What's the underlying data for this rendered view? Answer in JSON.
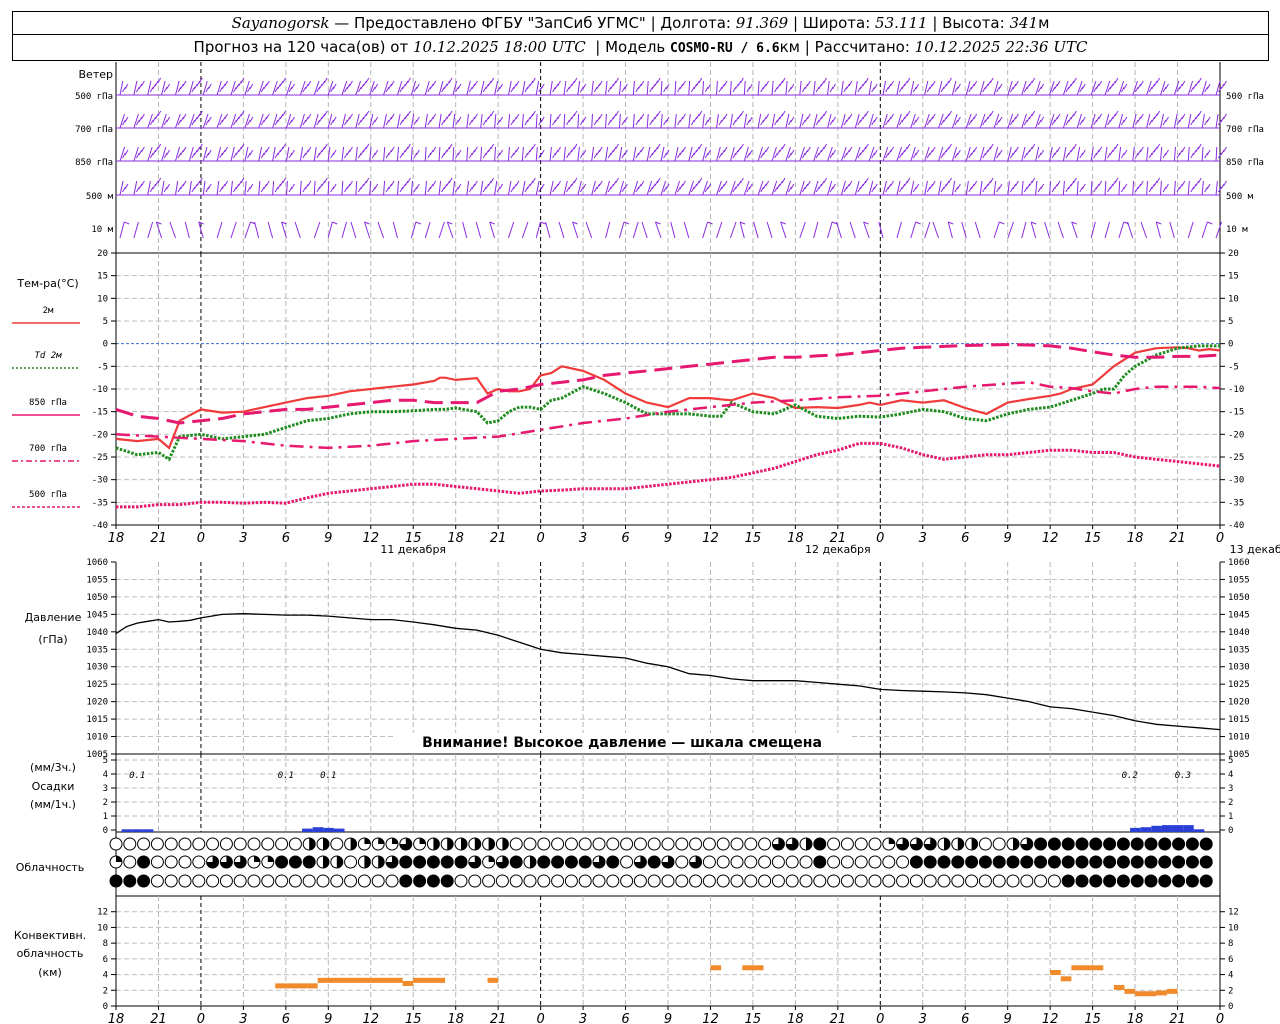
{
  "header": {
    "station": "Sayanogorsk",
    "provider": " — Предоставлено ФГБУ \"ЗапСиб УГМС\" | Долгота: ",
    "lon": "91.369",
    "lat_label": " | Широта: ",
    "lat": "53.111",
    "alt_label": " | Высота: ",
    "alt": "341",
    "alt_unit": "м",
    "forecast_prefix": "Прогноз на 120 часа(ов) от ",
    "forecast_start": "10.12.2025 18:00 UTC",
    "model_prefix": "  | Модель ",
    "model": "COSMO-RU / 6.6",
    "model_unit": "км",
    "calc_prefix": " | Рассчитано: ",
    "calc_time": "10.12.2025 22:36 UTC"
  },
  "wind_panel": {
    "title": "Ветер",
    "levels": [
      "500 гПа",
      "700 гПа",
      "850 гПа",
      "500 м",
      "10  м"
    ],
    "color": "#8a2be2"
  },
  "chart_data": [
    {
      "type": "line",
      "title": "Тем-ра(°C)",
      "x_ticks": [
        "18",
        "21",
        "0",
        "3",
        "6",
        "9",
        "12",
        "15",
        "18",
        "21",
        "0",
        "3",
        "6",
        "9",
        "12",
        "15",
        "18",
        "21",
        "0",
        "3",
        "6",
        "9",
        "12",
        "15",
        "18",
        "21",
        "0"
      ],
      "day_labels": [
        "11 декабря",
        "12 декабря",
        "13 декабря"
      ],
      "ylim": [
        -40,
        20
      ],
      "y_ticks": [
        20,
        15,
        10,
        5,
        0,
        -5,
        -10,
        -15,
        -20,
        -25,
        -30,
        -35,
        -40
      ],
      "series": [
        {
          "name": "2м",
          "color": "#ef3b3b",
          "style": "solid",
          "x": [
            0,
            2,
            4,
            5,
            6,
            8,
            10,
            12,
            14,
            16,
            18,
            20,
            22,
            24,
            26,
            28,
            30,
            30.5,
            31,
            32,
            34,
            35,
            36,
            37,
            38,
            39,
            40,
            41,
            42,
            44,
            46,
            48,
            50,
            52,
            54,
            56,
            57,
            58,
            60,
            62,
            64,
            66,
            68,
            70,
            71,
            72,
            74,
            76,
            78,
            80,
            82,
            84,
            86,
            88,
            89,
            90,
            92,
            93,
            94,
            96,
            98,
            100,
            101,
            102,
            103,
            104
          ],
          "values": [
            -21,
            -21.5,
            -21,
            -23,
            -17,
            -14.5,
            -15.2,
            -15,
            -14,
            -13,
            -12,
            -11.5,
            -10.5,
            -10,
            -9.5,
            -9,
            -8.2,
            -7.5,
            -7.5,
            -8,
            -7.6,
            -11,
            -10,
            -10.5,
            -10.5,
            -10,
            -7,
            -6.5,
            -5,
            -6,
            -8,
            -11,
            -13,
            -14,
            -12,
            -12,
            -12.3,
            -12.5,
            -11,
            -12,
            -14.2,
            -14.0,
            -14.2,
            -13.5,
            -13,
            -13.5,
            -12.5,
            -13,
            -12.5,
            -14.2,
            -15.5,
            -13,
            -12.2,
            -11.5,
            -11,
            -10,
            -9,
            -7,
            -5,
            -2,
            -1,
            -0.8,
            -1,
            -1.5,
            -1.2,
            -1.5
          ]
        },
        {
          "name": "Td 2м",
          "color": "#1e8c1e",
          "style": "dotted",
          "x": [
            0,
            2,
            4,
            5,
            6,
            8,
            10,
            12,
            14,
            16,
            18,
            20,
            22,
            24,
            26,
            28,
            30,
            31,
            32,
            34,
            35,
            36,
            37,
            38,
            39,
            40,
            41,
            42,
            44,
            46,
            48,
            50,
            52,
            54,
            56,
            57,
            58,
            60,
            62,
            64,
            66,
            68,
            70,
            72,
            74,
            76,
            78,
            80,
            82,
            84,
            86,
            88,
            90,
            92,
            93,
            94,
            95,
            96,
            98,
            100,
            102,
            104
          ],
          "values": [
            -23,
            -24.5,
            -24,
            -25.5,
            -20.5,
            -20,
            -21,
            -20.5,
            -20,
            -18.5,
            -17,
            -16.5,
            -15.5,
            -15,
            -15,
            -14.8,
            -14.5,
            -14.5,
            -14.2,
            -15,
            -17.5,
            -17,
            -15,
            -14,
            -14,
            -14.5,
            -12.5,
            -12,
            -9.5,
            -11,
            -13,
            -15.5,
            -15.5,
            -15.5,
            -16,
            -16,
            -13,
            -15,
            -15.5,
            -13.5,
            -16,
            -16.5,
            -16,
            -16.2,
            -15.5,
            -14.5,
            -15,
            -16.5,
            -17,
            -15.5,
            -14.5,
            -14,
            -12.5,
            -11,
            -10,
            -10,
            -7,
            -5,
            -2.5,
            -1,
            -0.5,
            -0.5
          ]
        },
        {
          "name": "850 гПа",
          "color": "#e6186f",
          "style": "longdash",
          "x": [
            0,
            2,
            4,
            6,
            8,
            10,
            12,
            14,
            16,
            18,
            20,
            22,
            24,
            26,
            28,
            30,
            32,
            34,
            36,
            38,
            40,
            42,
            44,
            46,
            48,
            50,
            52,
            54,
            56,
            58,
            60,
            62,
            64,
            66,
            68,
            70,
            72,
            74,
            76,
            78,
            80,
            82,
            84,
            86,
            88,
            90,
            92,
            94,
            96,
            98,
            100,
            102,
            104
          ],
          "values": [
            -14.5,
            -16,
            -16.5,
            -17.5,
            -17,
            -16.5,
            -15.5,
            -15,
            -14.5,
            -14.5,
            -14,
            -13.5,
            -13,
            -12.5,
            -12.5,
            -13,
            -13,
            -13,
            -10.5,
            -10,
            -9,
            -8.5,
            -8,
            -7,
            -6.5,
            -6,
            -5.5,
            -5,
            -4.5,
            -4,
            -3.5,
            -3,
            -3,
            -2.7,
            -2.5,
            -2,
            -1.5,
            -1,
            -0.8,
            -0.6,
            -0.4,
            -0.3,
            -0.2,
            -0.3,
            -0.5,
            -1,
            -1.8,
            -2.5,
            -3,
            -3,
            -2.8,
            -2.8,
            -2.5
          ]
        },
        {
          "name": "700 гПа",
          "color": "#e6186f",
          "style": "dashdot",
          "x": [
            0,
            4,
            8,
            12,
            16,
            20,
            24,
            28,
            32,
            36,
            40,
            44,
            48,
            52,
            56,
            60,
            64,
            68,
            72,
            76,
            80,
            84,
            86,
            88,
            90,
            92,
            94,
            96,
            98,
            100,
            102,
            104
          ],
          "values": [
            -20,
            -20.5,
            -21,
            -21.5,
            -22.5,
            -23,
            -22.5,
            -21.5,
            -21,
            -20.5,
            -19,
            -17.5,
            -16.5,
            -15,
            -14,
            -13,
            -12.5,
            -11.8,
            -11.5,
            -10.5,
            -9.5,
            -8.8,
            -8.5,
            -9.5,
            -9.8,
            -10.5,
            -11,
            -10,
            -9.5,
            -9.5,
            -9.5,
            -9.8
          ]
        },
        {
          "name": "500 гПа",
          "color": "#e6186f",
          "style": "densedot",
          "x": [
            0,
            2,
            4,
            6,
            8,
            10,
            12,
            14,
            16,
            18,
            20,
            22,
            24,
            26,
            28,
            30,
            32,
            34,
            36,
            38,
            40,
            42,
            44,
            46,
            48,
            50,
            52,
            54,
            56,
            58,
            60,
            62,
            64,
            66,
            68,
            70,
            72,
            74,
            76,
            78,
            80,
            82,
            84,
            86,
            88,
            90,
            92,
            94,
            96,
            98,
            100,
            102,
            104
          ],
          "values": [
            -36,
            -36,
            -35.5,
            -35.5,
            -35,
            -35,
            -35.2,
            -35,
            -35.2,
            -34,
            -33,
            -32.5,
            -32,
            -31.5,
            -31,
            -31,
            -31.5,
            -32,
            -32.5,
            -33,
            -32.5,
            -32.3,
            -32,
            -32,
            -32,
            -31.5,
            -31,
            -30.5,
            -30,
            -29.5,
            -28.5,
            -27.5,
            -26,
            -24.5,
            -23.5,
            -22,
            -22,
            -23,
            -24.5,
            -25.5,
            -25,
            -24.5,
            -24.5,
            -24,
            -23.5,
            -23.5,
            -24,
            -24,
            -25,
            -25.5,
            -26,
            -26.5,
            -27
          ]
        }
      ]
    },
    {
      "type": "line",
      "title": "Давление",
      "ylabel": "(гПа)",
      "ylim": [
        1005,
        1060
      ],
      "y_ticks": [
        1060,
        1055,
        1050,
        1045,
        1040,
        1035,
        1030,
        1025,
        1020,
        1015,
        1010,
        1005
      ],
      "note": "Внимание! Высокое давление — шкала смещена",
      "series": [
        {
          "name": "Давление",
          "color": "#000000",
          "x": [
            0,
            1,
            2,
            3,
            4,
            5,
            6,
            7,
            8,
            10,
            12,
            14,
            16,
            18,
            20,
            22,
            24,
            26,
            28,
            30,
            32,
            34,
            36,
            38,
            40,
            42,
            44,
            46,
            48,
            50,
            52,
            54,
            56,
            58,
            60,
            62,
            64,
            66,
            68,
            70,
            72,
            74,
            76,
            78,
            80,
            82,
            84,
            86,
            88,
            90,
            92,
            94,
            96,
            98,
            100,
            102,
            104
          ],
          "values": [
            1039.5,
            1041.5,
            1042.5,
            1043,
            1043.5,
            1042.8,
            1043,
            1043.3,
            1044,
            1045,
            1045.2,
            1045,
            1044.8,
            1044.8,
            1044.5,
            1044,
            1043.5,
            1043.5,
            1042.8,
            1042,
            1041,
            1040.5,
            1039,
            1037,
            1035,
            1034,
            1033.5,
            1033,
            1032.5,
            1031,
            1030,
            1028,
            1027.5,
            1026.5,
            1026,
            1026,
            1026,
            1025.5,
            1025,
            1024.5,
            1023.5,
            1023.2,
            1023,
            1022.8,
            1022.5,
            1022,
            1021,
            1020,
            1018.5,
            1018,
            1017,
            1016,
            1014.5,
            1013.5,
            1013,
            1012.5,
            1012
          ]
        }
      ]
    },
    {
      "type": "bar",
      "title": "Осадки",
      "ylabel_top": "(мм/3ч.)",
      "ylabel_bottom": "(мм/1ч.)",
      "ylim": [
        0,
        5
      ],
      "y_ticks": [
        5,
        4,
        3,
        2,
        1,
        0
      ],
      "annotations": [
        {
          "x": 2,
          "text": "0.1"
        },
        {
          "x": 16,
          "text": "0.1"
        },
        {
          "x": 20,
          "text": "0.1"
        },
        {
          "x": 95.5,
          "text": "0.2"
        },
        {
          "x": 100.5,
          "text": "0.3"
        }
      ],
      "series": [
        {
          "name": "Осадки",
          "color": "#2a3fd6",
          "x": [
            1,
            2,
            3,
            18,
            19,
            20,
            21,
            96,
            97,
            98,
            99,
            100,
            101,
            102
          ],
          "values": [
            0.05,
            0.05,
            0.05,
            0.1,
            0.2,
            0.15,
            0.1,
            0.15,
            0.2,
            0.3,
            0.35,
            0.35,
            0.35,
            0.05
          ]
        }
      ]
    },
    {
      "type": "bar",
      "title": "Конвективн. облачность",
      "ylabel": "(км)",
      "ylim": [
        0,
        14
      ],
      "y_ticks": [
        12,
        10,
        8,
        6,
        4,
        2,
        0
      ],
      "series": [
        {
          "name": "Конвективн. облачность",
          "color": "#f08a2a",
          "segments": [
            {
              "x0": 15,
              "x1": 18,
              "value": 2.5
            },
            {
              "x0": 18,
              "x1": 19,
              "value": 2.5
            },
            {
              "x0": 19,
              "x1": 27,
              "value": 3.2
            },
            {
              "x0": 27,
              "x1": 28,
              "value": 2.8
            },
            {
              "x0": 28,
              "x1": 31,
              "value": 3.2
            },
            {
              "x0": 35,
              "x1": 36,
              "value": 3.2
            },
            {
              "x0": 56,
              "x1": 57,
              "value": 4.8
            },
            {
              "x0": 59,
              "x1": 61,
              "value": 4.8
            },
            {
              "x0": 88,
              "x1": 89,
              "value": 4.2
            },
            {
              "x0": 89,
              "x1": 90,
              "value": 3.4
            },
            {
              "x0": 90,
              "x1": 93,
              "value": 4.8
            },
            {
              "x0": 94,
              "x1": 95,
              "value": 2.3
            },
            {
              "x0": 95,
              "x1": 96,
              "value": 1.8
            },
            {
              "x0": 96,
              "x1": 98,
              "value": 1.5
            },
            {
              "x0": 98,
              "x1": 99,
              "value": 1.6
            },
            {
              "x0": 99,
              "x1": 100,
              "value": 1.8
            }
          ]
        }
      ]
    }
  ],
  "cloud_panel": {
    "title": "Облачность",
    "rows": [
      "00000000000000000000222202211112312222222222000000000000000000000000000013312400000001323332022000123344444444444444444444",
      "10400000003303111444442240232344444444311324234444423440304303304000000000040003000004444444444444444444444444444444444",
      "44440200000000000000000000000004444444000000000000000000000000000000000000000000000000000000000000000000444444444444444444"
    ]
  }
}
